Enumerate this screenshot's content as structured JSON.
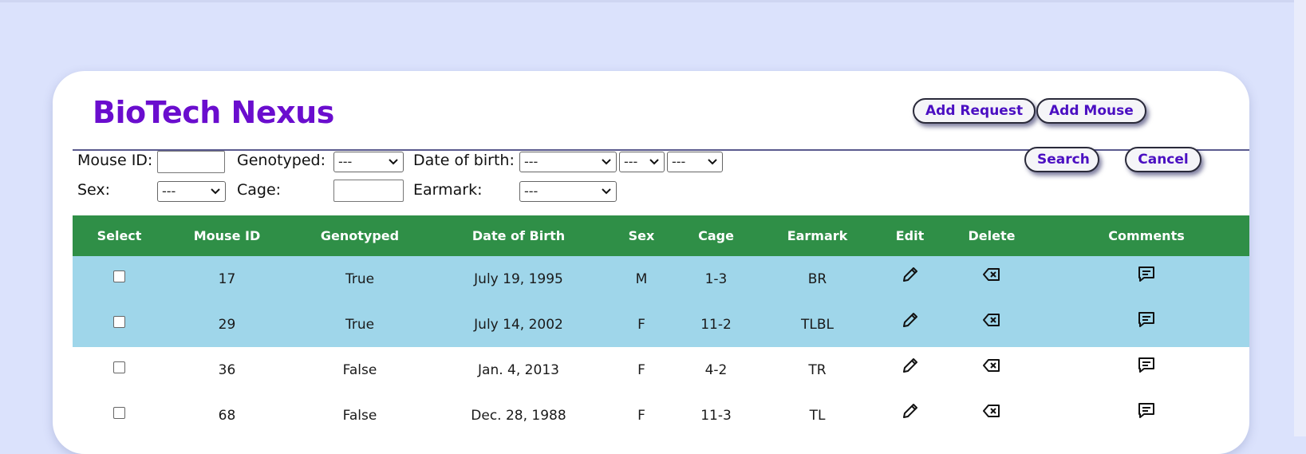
{
  "app": {
    "title": "BioTech Nexus"
  },
  "actions": {
    "add_request": "Add Request",
    "add_mouse": "Add Mouse",
    "search": "Search",
    "cancel": "Cancel"
  },
  "filters": {
    "mouse_id_label": "Mouse ID:",
    "genotyped_label": "Genotyped:",
    "genotyped_value": "---",
    "dob_label": "Date of birth:",
    "dob_month_value": "---",
    "dob_day_value": "---",
    "dob_year_value": "---",
    "sex_label": "Sex:",
    "sex_value": "---",
    "cage_label": "Cage:",
    "earmark_label": "Earmark:",
    "earmark_value": "---"
  },
  "table": {
    "headers": [
      "Select",
      "Mouse ID",
      "Genotyped",
      "Date of Birth",
      "Sex",
      "Cage",
      "Earmark",
      "Edit",
      "Delete",
      "Comments"
    ],
    "rows": [
      {
        "id": "17",
        "genotyped": "True",
        "dob": "July 19, 1995",
        "sex": "M",
        "cage": "1-3",
        "earmark": "BR",
        "highlighted": true
      },
      {
        "id": "29",
        "genotyped": "True",
        "dob": "July 14, 2002",
        "sex": "F",
        "cage": "11-2",
        "earmark": "TLBL",
        "highlighted": true
      },
      {
        "id": "36",
        "genotyped": "False",
        "dob": "Jan. 4, 2013",
        "sex": "F",
        "cage": "4-2",
        "earmark": "TR",
        "highlighted": false
      },
      {
        "id": "68",
        "genotyped": "False",
        "dob": "Dec. 28, 1988",
        "sex": "F",
        "cage": "11-3",
        "earmark": "TL",
        "highlighted": false
      }
    ]
  },
  "icons": {
    "edit": "pencil-icon",
    "delete": "backspace-x-icon",
    "comments": "comment-bubble-icon"
  },
  "colors": {
    "page_bg": "#dbe2fc",
    "title": "#6a0dce",
    "header_bg": "#2f8f47",
    "highlight_row": "#9fd6ea",
    "button_text": "#4b0fc2"
  }
}
